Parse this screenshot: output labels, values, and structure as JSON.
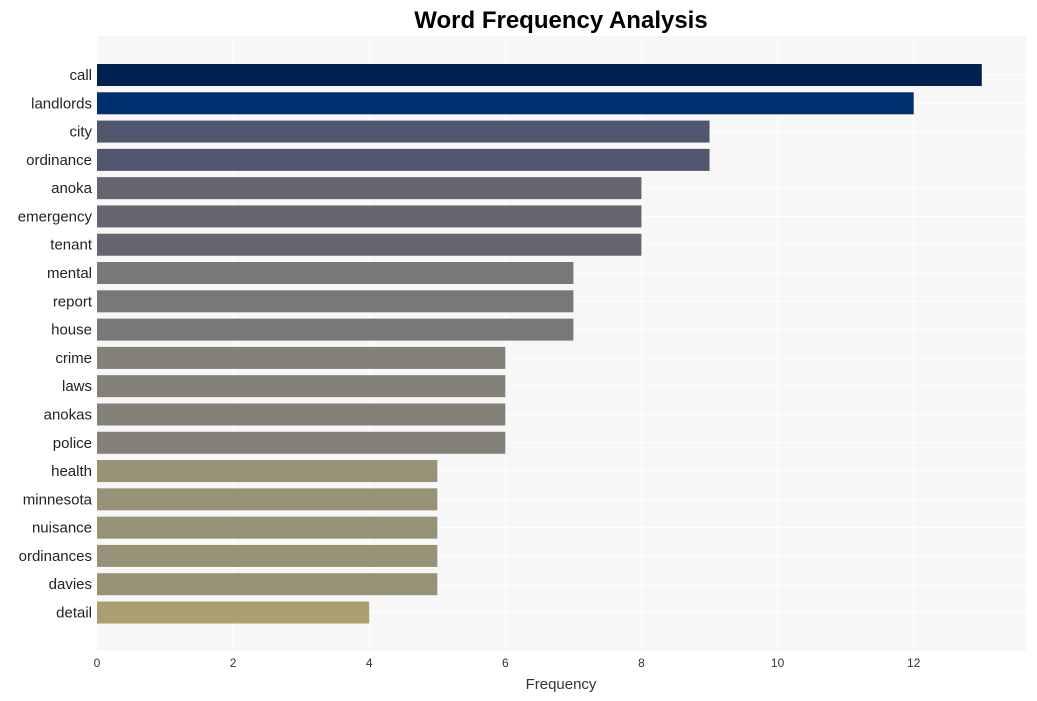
{
  "chart_data": {
    "type": "bar",
    "orientation": "horizontal",
    "title": "Word Frequency Analysis",
    "xlabel": "Frequency",
    "ylabel": "",
    "xlim": [
      0,
      13.65
    ],
    "xticks": [
      0,
      2,
      4,
      6,
      8,
      10,
      12
    ],
    "grid": true,
    "legend": "none",
    "categories": [
      "call",
      "landlords",
      "city",
      "ordinance",
      "anoka",
      "emergency",
      "tenant",
      "mental",
      "report",
      "house",
      "crime",
      "laws",
      "anokas",
      "police",
      "health",
      "minnesota",
      "nuisance",
      "ordinances",
      "davies",
      "detail"
    ],
    "values": [
      13,
      12,
      9,
      9,
      8,
      8,
      8,
      7,
      7,
      7,
      6,
      6,
      6,
      6,
      5,
      5,
      5,
      5,
      5,
      4
    ],
    "colors": [
      "#00204f",
      "#002f6e",
      "#4f566d",
      "#4f566d",
      "#656671",
      "#656671",
      "#656671",
      "#787878",
      "#787878",
      "#787878",
      "#838178",
      "#838178",
      "#838178",
      "#838178",
      "#979276",
      "#979276",
      "#979276",
      "#979276",
      "#979276",
      "#ab9f72"
    ]
  },
  "style": {
    "plot_background": "#f7f7f7",
    "grid_color": "#ffffff"
  }
}
